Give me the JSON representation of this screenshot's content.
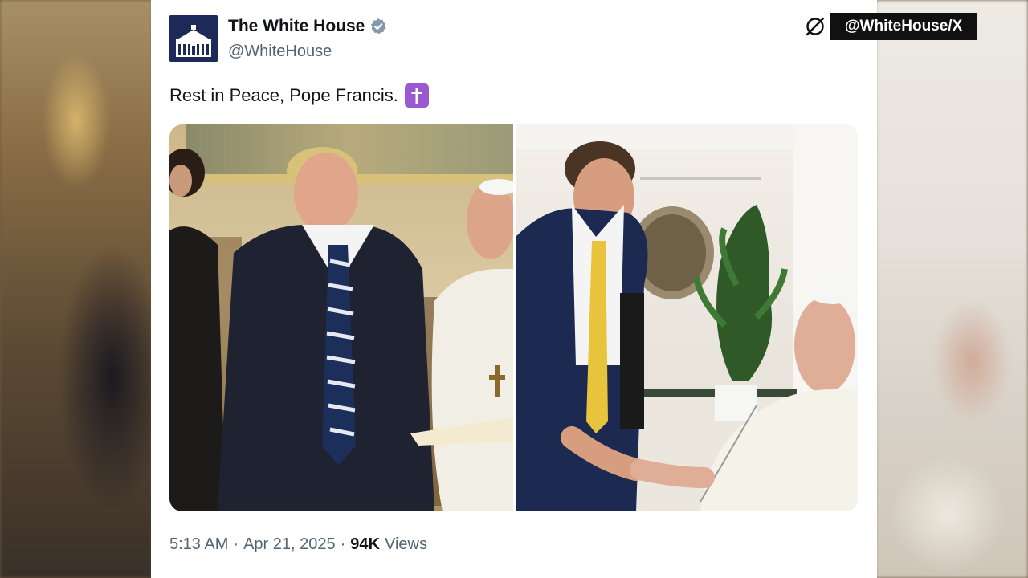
{
  "post": {
    "author_name": "The White House",
    "author_handle": "@WhiteHouse",
    "verified": true,
    "text": "Rest in Peace, Pope Francis.",
    "emoji": "latin-cross-emoji",
    "time": "5:13 AM",
    "separator": "·",
    "date": "Apr 21, 2025",
    "views_count": "94K",
    "views_label": "Views"
  },
  "watermark": {
    "label": "@WhiteHouse/X",
    "icon": "x-logo-icon"
  },
  "colors": {
    "text_primary": "#0f1419",
    "text_secondary": "#536471",
    "verified_badge": "#829aab",
    "emoji_bg": "#9b59d0",
    "avatar_bg": "#1d2a59"
  }
}
